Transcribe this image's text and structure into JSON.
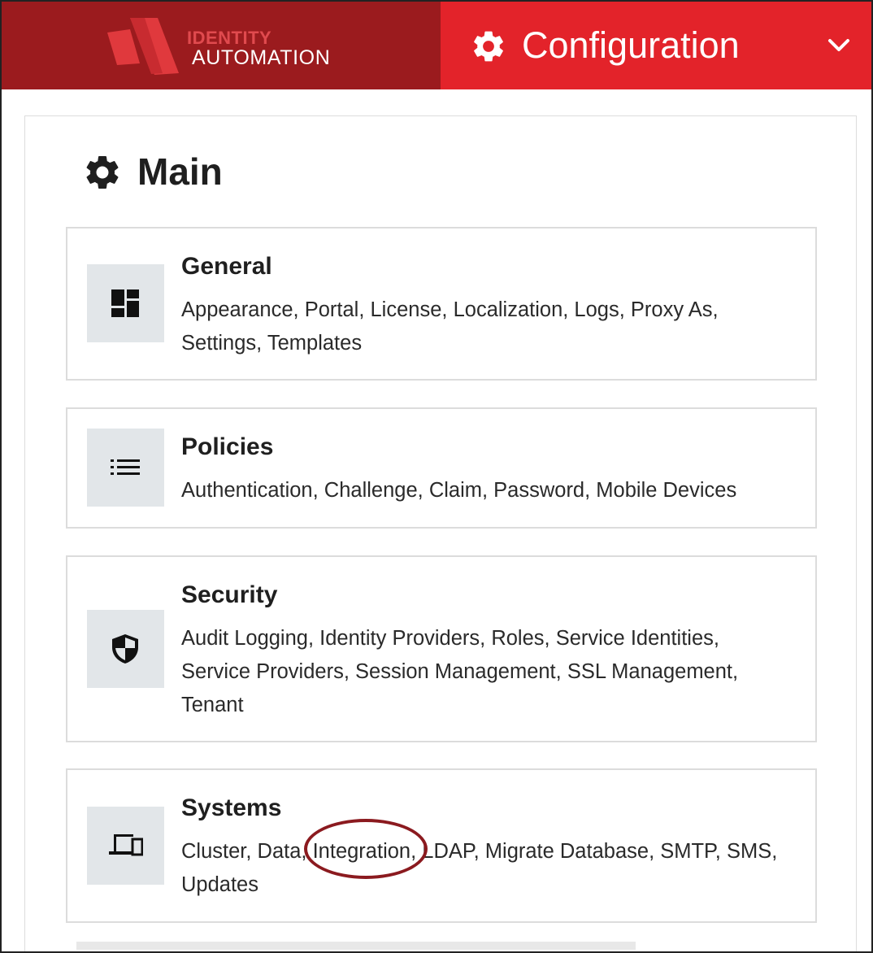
{
  "header": {
    "brand_line1": "IDENTITY",
    "brand_line2": "AUTOMATION",
    "title": "Configuration",
    "brand_color": "#9b1b1e",
    "accent_color": "#e3232a",
    "icons": {
      "title": "gear-icon",
      "menu": "chevron-down-icon"
    }
  },
  "main": {
    "title": "Main",
    "icon": "gear-icon",
    "cards": [
      {
        "title": "General",
        "icon": "dashboard-icon",
        "items": [
          "Appearance",
          "Portal",
          "License",
          "Localization",
          "Logs",
          "Proxy As",
          "Settings",
          "Templates"
        ]
      },
      {
        "title": "Policies",
        "icon": "list-icon",
        "items": [
          "Authentication",
          "Challenge",
          "Claim",
          "Password",
          "Mobile Devices"
        ]
      },
      {
        "title": "Security",
        "icon": "shield-icon",
        "items": [
          "Audit Logging",
          "Identity Providers",
          "Roles",
          "Service Identities",
          "Service Providers",
          "Session Management",
          "SSL Management",
          "Tenant"
        ]
      },
      {
        "title": "Systems",
        "icon": "devices-icon",
        "items": [
          "Cluster",
          "Data",
          "Integration",
          "LDAP",
          "Migrate Database",
          "SMTP",
          "SMS",
          "Updates"
        ]
      }
    ]
  },
  "annotation": {
    "highlighted_item": "Integration",
    "color": "#8b1a1f"
  }
}
